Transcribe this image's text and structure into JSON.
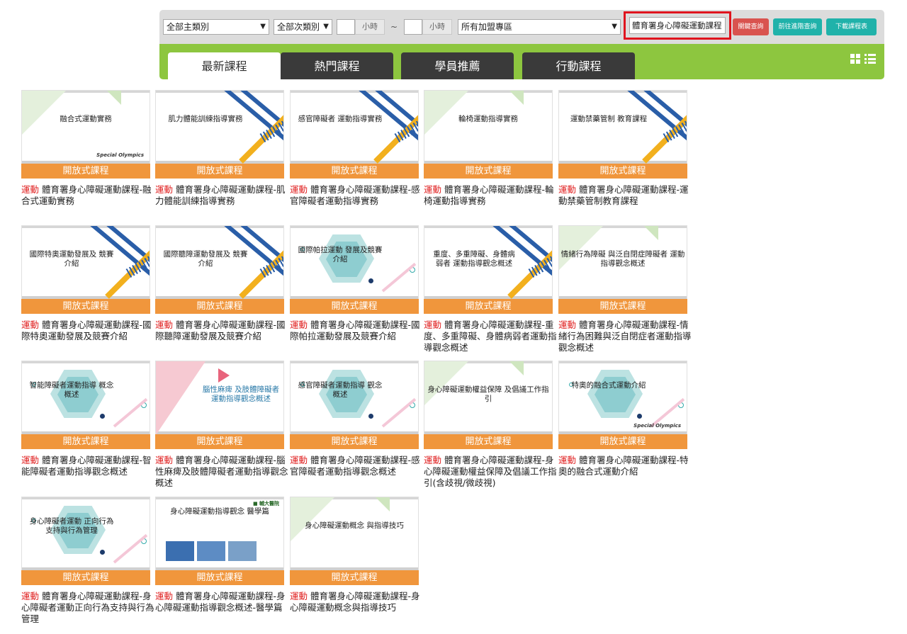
{
  "filters": {
    "main_category": "全部主類別",
    "sub_category": "全部次類別",
    "hour_from_unit": "小時",
    "range_sep": "~",
    "hour_to_unit": "小時",
    "region": "所有加盟專區",
    "keyword": "體育署身心障礙運動課程",
    "search_button": "關鍵查詢",
    "advanced_button": "前往進階查詢",
    "download_button": "下載課程表"
  },
  "tabs": [
    {
      "label": "最新課程",
      "active": true
    },
    {
      "label": "熱門課程",
      "active": false
    },
    {
      "label": "學員推薦",
      "active": false
    },
    {
      "label": "行動課程",
      "active": false
    }
  ],
  "view_icons": [
    "grid-view-icon",
    "list-view-icon"
  ],
  "courses": [
    {
      "type": "開放式課程",
      "tag": "運動",
      "title": "體育署身心障礙運動課程-融合式運動實務",
      "thumb_title": "融合式運動實務",
      "style": "green-so"
    },
    {
      "type": "開放式課程",
      "tag": "運動",
      "title": "體育署身心障礙運動課程-肌力體能訓練指導實務",
      "thumb_title": "肌力體能訓練指導實務",
      "style": "stripe"
    },
    {
      "type": "開放式課程",
      "tag": "運動",
      "title": "體育署身心障礙運動課程-感官障礙者運動指導實務",
      "thumb_title": "感官障礙者 運動指導實務",
      "style": "stripe"
    },
    {
      "type": "開放式課程",
      "tag": "運動",
      "title": "體育署身心障礙運動課程-輪椅運動指導實務",
      "thumb_title": "輪椅運動指導實務",
      "style": "green"
    },
    {
      "type": "開放式課程",
      "tag": "運動",
      "title": "體育署身心障礙運動課程-運動禁藥管制教育課程",
      "thumb_title": "運動禁藥管制 教育課程",
      "style": "stripe"
    },
    {
      "type": "開放式課程",
      "tag": "運動",
      "title": "體育署身心障礙運動課程-國際特奧運動發展及競賽介紹",
      "thumb_title": "國際特奧運動發展及 競賽介紹",
      "style": "stripe"
    },
    {
      "type": "開放式課程",
      "tag": "運動",
      "title": "體育署身心障礙運動課程-國際聽障運動發展及競賽介紹",
      "thumb_title": "國際聽障運動發展及 競賽介紹",
      "style": "stripe"
    },
    {
      "type": "開放式課程",
      "tag": "運動",
      "title": "體育署身心障礙運動課程-國際帕拉運動發展及競賽介紹",
      "thumb_title": "國際帕拉運動 發展及競賽介紹",
      "style": "hex"
    },
    {
      "type": "開放式課程",
      "tag": "運動",
      "title": "體育署身心障礙運動課程-重度、多重障礙、身體病弱者運動指導觀念概述",
      "thumb_title": "重度、多重障礙、身體病弱者 運動指導觀念概述",
      "style": "stripe"
    },
    {
      "type": "開放式課程",
      "tag": "運動",
      "title": "體育署身心障礙運動課程-情緒行為困難與泛自閉症者運動指導觀念概述",
      "thumb_title": "情緒行為障礙 與泛自閉症障礙者 運動指導觀念概述",
      "style": "green"
    },
    {
      "type": "開放式課程",
      "tag": "運動",
      "title": "體育署身心障礙運動課程-智能障礙者運動指導觀念概述",
      "thumb_title": "智能障礙者運動指導 概念概述",
      "style": "hex"
    },
    {
      "type": "開放式課程",
      "tag": "運動",
      "title": "體育署身心障礙運動課程-腦性麻痺及肢體障礙者運動指導觀念概述",
      "thumb_title": "腦性麻痺 及肢體障礙者 運動指導觀念概述",
      "style": "pink"
    },
    {
      "type": "開放式課程",
      "tag": "運動",
      "title": "體育署身心障礙運動課程-感官障礙者運動指導觀念概述",
      "thumb_title": "感官障礙者運動指導 觀念概述",
      "style": "hex"
    },
    {
      "type": "開放式課程",
      "tag": "運動",
      "title": "體育署身心障礙運動課程-身心障礙運動權益保障及倡議工作指引(含歧視/微歧視)",
      "thumb_title": "身心障礙運動權益保障 及倡議工作指引",
      "style": "green"
    },
    {
      "type": "開放式課程",
      "tag": "運動",
      "title": "體育署身心障礙運動課程-特奧的融合式運動介紹",
      "thumb_title": "特奧的融合式運動介紹",
      "style": "hex-so"
    },
    {
      "type": "開放式課程",
      "tag": "運動",
      "title": "體育署身心障礙運動課程-身心障礙者運動正向行為支持與行為管理",
      "thumb_title": "身心障礙者運動 正向行為支持與行為管理",
      "style": "hex"
    },
    {
      "type": "開放式課程",
      "tag": "運動",
      "title": "體育署身心障礙運動課程-身心障礙運動指導觀念概述-醫學篇",
      "thumb_title": "身心障礙運動指導觀念 醫學篇",
      "style": "photo"
    },
    {
      "type": "開放式課程",
      "tag": "運動",
      "title": "體育署身心障礙運動課程-身心障礙運動概念與指導技巧",
      "thumb_title": "身心障礙運動概念 與指導技巧",
      "style": "green"
    }
  ]
}
